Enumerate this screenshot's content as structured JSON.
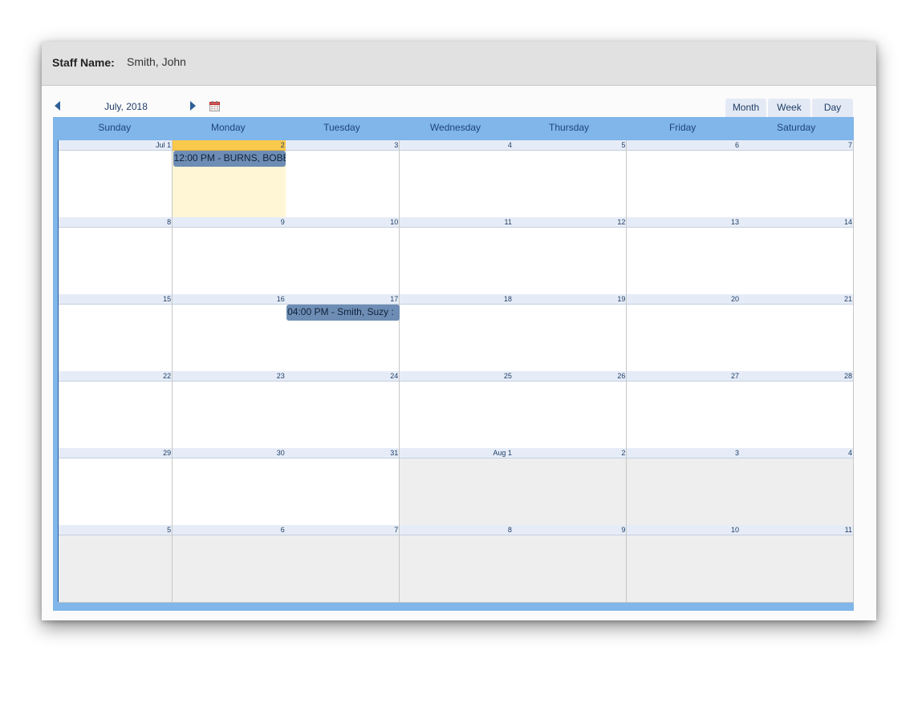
{
  "header": {
    "staff_label": "Staff Name:",
    "staff_name": "Smith, John"
  },
  "nav": {
    "month_title": "July, 2018",
    "prev_icon": "triangle-left",
    "next_icon": "triangle-right",
    "calendar_icon": "calendar-icon"
  },
  "tabs": [
    {
      "label": "Month",
      "active": true
    },
    {
      "label": "Week",
      "active": false
    },
    {
      "label": "Day",
      "active": false
    }
  ],
  "weekdays": [
    "Sunday",
    "Monday",
    "Tuesday",
    "Wednesday",
    "Thursday",
    "Friday",
    "Saturday"
  ],
  "weeks": [
    [
      {
        "label": "Jul 1"
      },
      {
        "label": "2",
        "today": true
      },
      {
        "label": "3"
      },
      {
        "label": "4"
      },
      {
        "label": "5"
      },
      {
        "label": "6"
      },
      {
        "label": "7"
      }
    ],
    [
      {
        "label": "8"
      },
      {
        "label": "9"
      },
      {
        "label": "10"
      },
      {
        "label": "11"
      },
      {
        "label": "12"
      },
      {
        "label": "13"
      },
      {
        "label": "14"
      }
    ],
    [
      {
        "label": "15"
      },
      {
        "label": "16"
      },
      {
        "label": "17"
      },
      {
        "label": "18"
      },
      {
        "label": "19"
      },
      {
        "label": "20"
      },
      {
        "label": "21"
      }
    ],
    [
      {
        "label": "22"
      },
      {
        "label": "23"
      },
      {
        "label": "24"
      },
      {
        "label": "25"
      },
      {
        "label": "26"
      },
      {
        "label": "27"
      },
      {
        "label": "28"
      }
    ],
    [
      {
        "label": "29"
      },
      {
        "label": "30"
      },
      {
        "label": "31"
      },
      {
        "label": "Aug 1",
        "other": true
      },
      {
        "label": "2",
        "other": true
      },
      {
        "label": "3",
        "other": true
      },
      {
        "label": "4",
        "other": true
      }
    ],
    [
      {
        "label": "5",
        "other": true
      },
      {
        "label": "6",
        "other": true
      },
      {
        "label": "7",
        "other": true
      },
      {
        "label": "8",
        "other": true
      },
      {
        "label": "9",
        "other": true
      },
      {
        "label": "10",
        "other": true
      },
      {
        "label": "11",
        "other": true
      }
    ]
  ],
  "events": [
    {
      "week": 0,
      "day": 1,
      "text": "12:00 PM - BURNS, BOBB"
    },
    {
      "week": 2,
      "day": 2,
      "text": "04:00 PM - Smith, Suzy :"
    }
  ],
  "colors": {
    "accent": "#80b6ea",
    "today_header": "#f9c94c",
    "today_bg": "#fff6d5",
    "event_bg": "#6e8db5",
    "other_month_bg": "#eeeeee"
  }
}
